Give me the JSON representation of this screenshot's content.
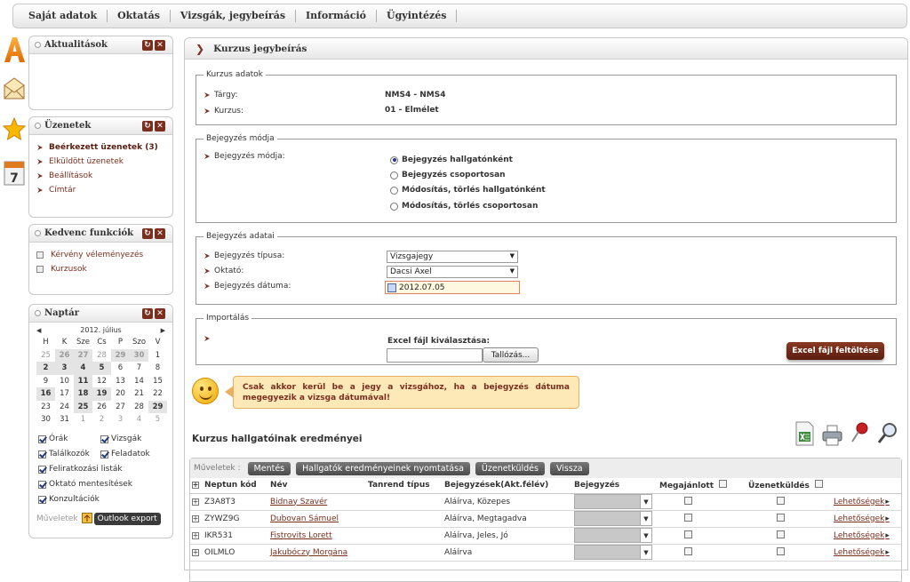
{
  "topnav": {
    "items": [
      "Saját adatok",
      "Oktatás",
      "Vizsgák, jegybeírás",
      "Információ",
      "Ügyintézés"
    ]
  },
  "rail": {
    "icons": [
      "font-a-icon",
      "envelope-icon",
      "star-icon",
      "calendar-7-icon"
    ],
    "calendar_day": "7"
  },
  "panels": {
    "news": {
      "title": "Aktualitások"
    },
    "messages": {
      "title": "Üzenetek",
      "items": [
        "Beérkezett üzenetek (3)",
        "Elküldött üzenetek",
        "Beállítások",
        "Címtár"
      ]
    },
    "favorites": {
      "title": "Kedvenc funkciók",
      "items": [
        "Kérvény véleményezés",
        "Kurzusok"
      ]
    },
    "calendar": {
      "title": "Naptár",
      "month": "2012. július",
      "weekdays": [
        "H",
        "K",
        "Sze",
        "Cs",
        "P",
        "Szo",
        "V"
      ],
      "weeks": [
        [
          "25",
          "26",
          "27",
          "28",
          "29",
          "30",
          "1"
        ],
        [
          "2",
          "3",
          "4",
          "5",
          "6",
          "7",
          "8"
        ],
        [
          "9",
          "10",
          "11",
          "12",
          "13",
          "14",
          "15"
        ],
        [
          "16",
          "17",
          "18",
          "19",
          "20",
          "21",
          "22"
        ],
        [
          "23",
          "24",
          "25",
          "26",
          "27",
          "28",
          "29"
        ],
        [
          "30",
          "31",
          "1",
          "2",
          "3",
          "4",
          "5"
        ]
      ],
      "checks": [
        {
          "label": "Órák",
          "checked": true
        },
        {
          "label": "Vizsgák",
          "checked": true
        },
        {
          "label": "Találkozók",
          "checked": true
        },
        {
          "label": "Feladatok",
          "checked": true
        },
        {
          "label": "Feliratkozási listák",
          "checked": true
        },
        {
          "label": "Oktató mentesítések",
          "checked": true
        },
        {
          "label": "Konzultációk",
          "checked": true
        }
      ],
      "actions_label": "Műveletek",
      "export_label": "Outlook export"
    }
  },
  "main": {
    "title": "Kurzus jegybeírás",
    "course": {
      "legend": "Kurzus adatok",
      "subject_label": "Tárgy:",
      "subject_value": "NMS4 - NMS4",
      "course_label": "Kurzus:",
      "course_value": "01 - Elmélet"
    },
    "mode": {
      "legend": "Bejegyzés módja",
      "label": "Bejegyzés módja:",
      "options": [
        {
          "label": "Bejegyzés hallgatónként",
          "selected": true
        },
        {
          "label": "Bejegyzés csoportosan",
          "selected": false
        },
        {
          "label": "Módosítás, törlés hallgatónként",
          "selected": false
        },
        {
          "label": "Módosítás, törlés csoportosan",
          "selected": false
        }
      ]
    },
    "entry": {
      "legend": "Bejegyzés adatai",
      "type_label": "Bejegyzés típusa:",
      "type_value": "Vizsgajegy",
      "teacher_label": "Oktató:",
      "teacher_value": "Dacsi Axel",
      "date_label": "Bejegyzés dátuma:",
      "date_value": "2012.07.05"
    },
    "import": {
      "legend": "Importálás",
      "file_label": "Excel fájl kiválasztása:",
      "browse_label": "Tallózás...",
      "upload_label": "Excel fájl feltöltése"
    },
    "notice": "Csak akkor kerül be a jegy a vizsgához, ha a bejegyzés dátuma megegyezik a vizsga dátumával!",
    "results_title": "Kurzus hallgatóinak eredményei",
    "tool_icons": [
      "excel-export-icon",
      "print-icon",
      "pin-icon",
      "magnifier-icon"
    ],
    "toolbar": {
      "label": "Műveletek :",
      "buttons": [
        "Mentés",
        "Hallgatók eredményeinek nyomtatása",
        "Üzenetküldés",
        "Vissza"
      ]
    },
    "table": {
      "columns": [
        "Neptun kód",
        "Név",
        "Tanrend típus",
        "Bejegyzések(Akt.félév)",
        "Bejegyzés",
        "Megajánlott",
        "Üzenetküldés"
      ],
      "more_label": "Lehetőségek",
      "rows": [
        {
          "code": "Z3A8T3",
          "name": "Bidnay Szavér",
          "entries": "Aláírva, Közepes"
        },
        {
          "code": "ZYWZ9G",
          "name": "Dubovan Sámuel",
          "entries": "Aláírva, Megtagadva"
        },
        {
          "code": "IKR531",
          "name": "Fistrovits Lorett",
          "entries": "Aláírva, Jeles, Jó"
        },
        {
          "code": "OILMLO",
          "name": "Jakubóczy Morgána",
          "entries": "Aláírva"
        }
      ]
    }
  }
}
